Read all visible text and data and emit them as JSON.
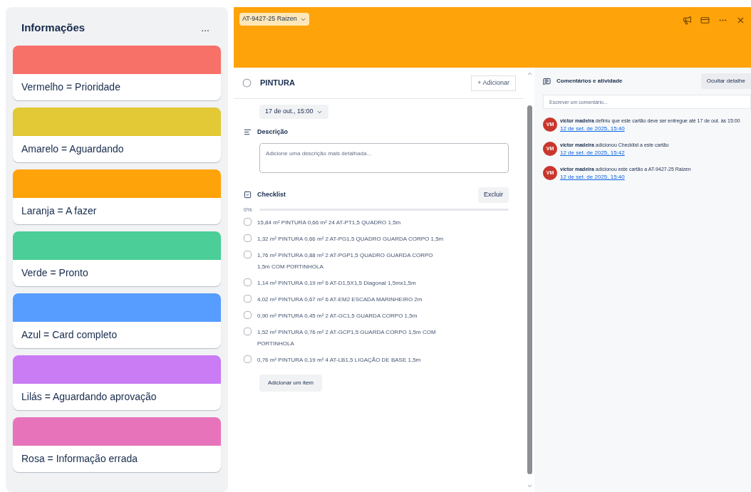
{
  "legend": {
    "title": "Informações",
    "menu": "...",
    "cards": [
      {
        "color": "#f87168",
        "label": "Vermelho = Prioridade"
      },
      {
        "color": "#e2c935",
        "label": "Amarelo = Aguardando"
      },
      {
        "color": "#fea309",
        "label": "Laranja = A fazer"
      },
      {
        "color": "#4bce97",
        "label": "Verde = Pronto"
      },
      {
        "color": "#579dff",
        "label": "Azul = Card completo"
      },
      {
        "color": "#c97cf4",
        "label": "Lilás = Aguardando aprovação"
      },
      {
        "color": "#e774bb",
        "label": "Rosa = Informação errada"
      }
    ]
  },
  "card": {
    "list_name": "AT-9427-25 Raizen",
    "title": "PINTURA",
    "completed": false,
    "add_button": "+ Adicionar",
    "due_date": "17 de out., 15:00",
    "description": {
      "heading": "Descrição",
      "placeholder": "Adicione uma descrição mais detalhada..."
    },
    "checklist": {
      "heading": "Checklist",
      "delete_button": "Excluir",
      "progress": "0%",
      "level": 0,
      "add_item": "Adicionar um item",
      "items": [
        {
          "text": "15,84 m² PINTURA 0,66 m² 24 AT-PT1,5 QUADRO 1,5m",
          "checked": false
        },
        {
          "text": "1,32 m² PINTURA 0,66 m² 2 AT-PG1,5 QUADRO GUARDA CORPO 1,5m",
          "checked": false
        },
        {
          "text": "1,76 m² PINTURA 0,88 m² 2 AT-PGP1,5 QUADRO GUARDA CORPO 1,5m COM PORTINHOLA",
          "checked": false
        },
        {
          "text": "1,14 m² PINTURA 0,19 m² 6 AT-D1,5X1,5 Diagonal 1,5mx1,5m",
          "checked": false
        },
        {
          "text": "4,02 m² PINTURA 0,67 m² 6 AT-EM2 ESCADA MARINHEIRO 2m",
          "checked": false
        },
        {
          "text": "0,90 m² PINTURA 0,45 m² 2 AT-GC1,5 GUARDA CORPO 1,5m",
          "checked": false
        },
        {
          "text": "1,52 m² PINTURA 0,76 m² 2 AT-GCP1,5 GUARDA CORPO 1,5m COM PORTINHOLA",
          "checked": false
        },
        {
          "text": "0,76 m² PINTURA 0,19 m² 4 AT-LB1,5 LIGAÇÃO DE BASE 1,5m",
          "checked": false
        }
      ]
    }
  },
  "activity": {
    "heading": "Comentários e atividade",
    "hide_button": "Ocultar detalhe",
    "comment_placeholder": "Escrever um comentário...",
    "entries": [
      {
        "initials": "VM",
        "text": "**victor madeira** definiu que este cartão deve ser entregue até 17 de out. às 15:00",
        "time": "12 de set. de 2025, 15:40"
      },
      {
        "initials": "VM",
        "text": "**victor madeira** adicionou Checklist a este cartão",
        "time": "12 de set. de 2025, 15:42"
      },
      {
        "initials": "VM",
        "text": "**victor madeira** adicionou este cartão a AT-9427-25 Raizen",
        "time": "12 de set. de 2025, 15:40"
      }
    ]
  }
}
